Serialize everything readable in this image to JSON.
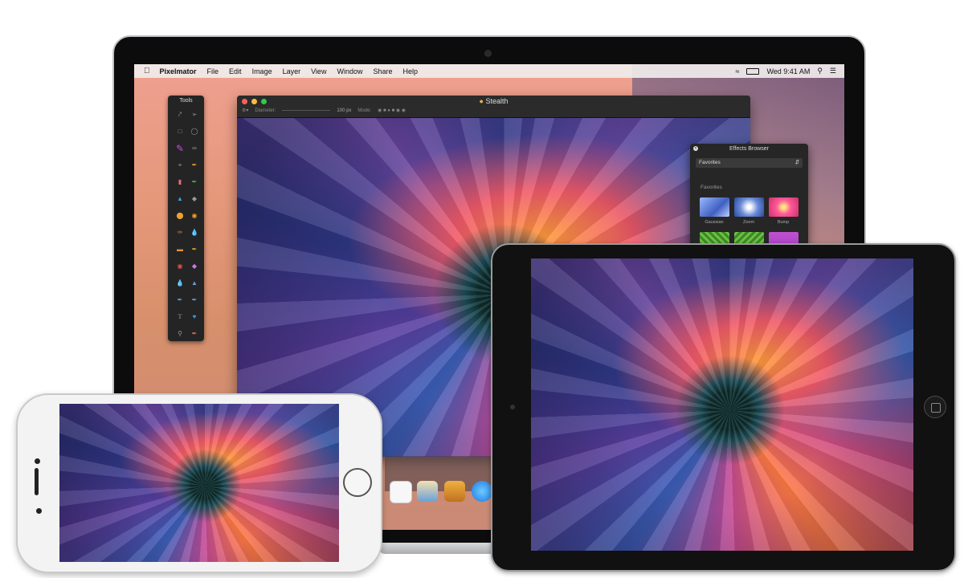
{
  "menubar": {
    "app_name": "Pixelmator",
    "items": [
      "File",
      "Edit",
      "Image",
      "Layer",
      "View",
      "Window",
      "Share",
      "Help"
    ],
    "clock": "Wed 9:41 AM"
  },
  "tools_panel": {
    "title": "Tools"
  },
  "document": {
    "title": "Stealth",
    "diameter_label": "Diameter:",
    "diameter_value": "100 px",
    "mode_label": "Mode:"
  },
  "effects_browser": {
    "title": "Effects Browser",
    "category": "Favorites",
    "section_label": "Favorites",
    "effects": [
      "Gaussian",
      "Zoom",
      "Bump"
    ]
  },
  "colors": {
    "close": "#fc605b",
    "minimize": "#fdbc40",
    "zoom": "#34c84a",
    "accent_purple": "#c04fe0"
  }
}
